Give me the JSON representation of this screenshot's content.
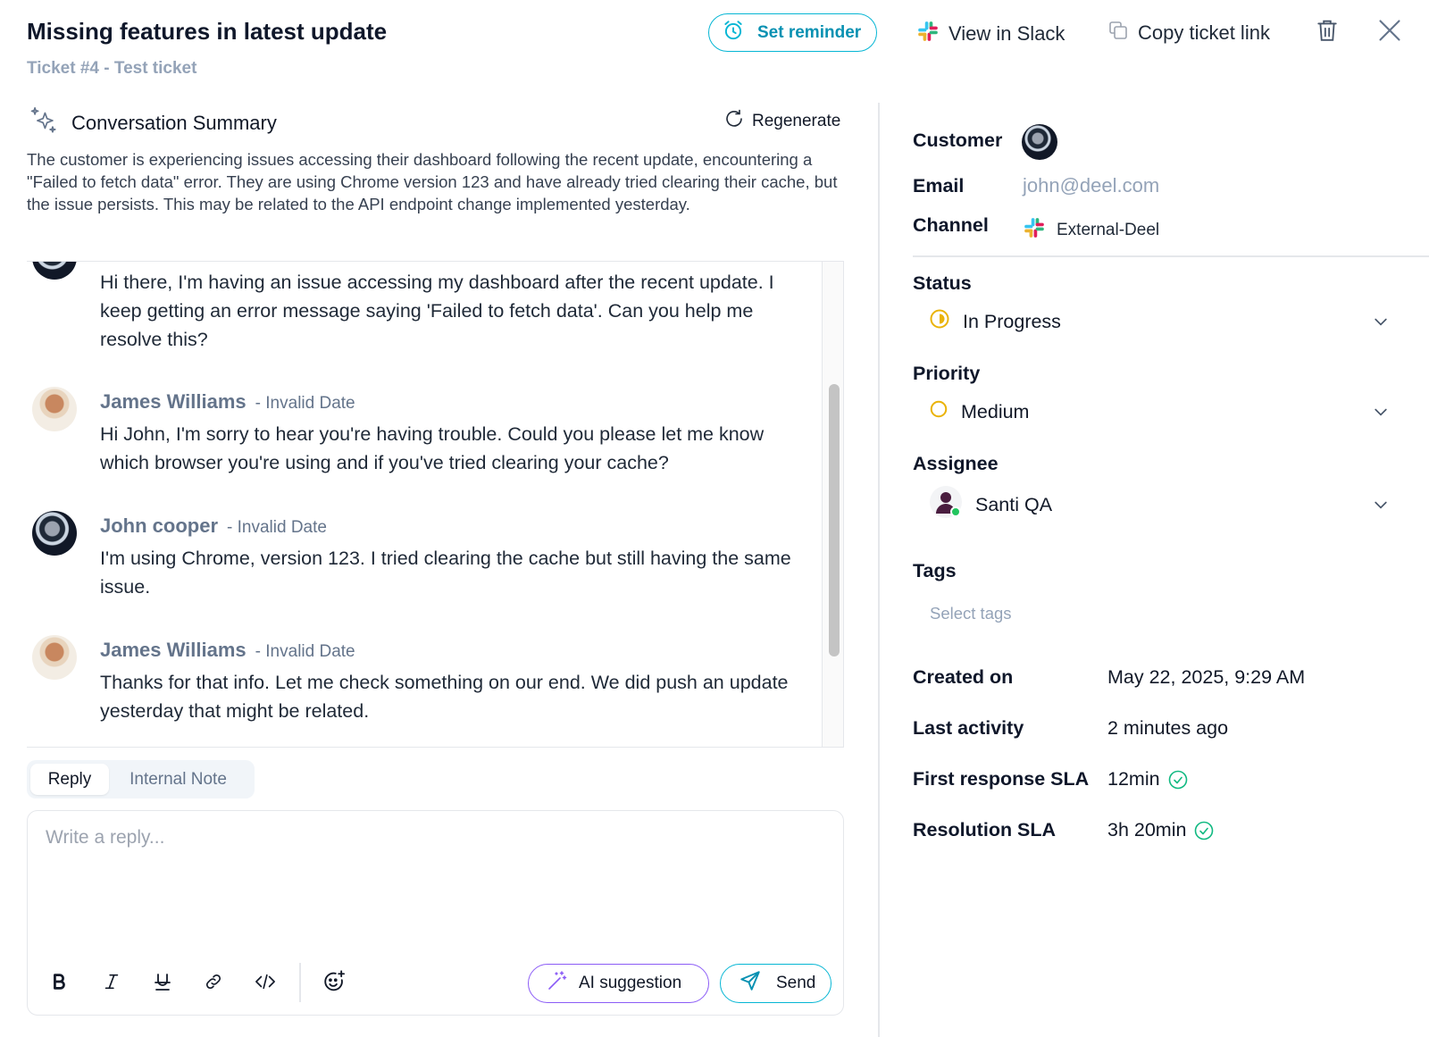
{
  "header": {
    "title": "Missing features in latest update",
    "subtitle": "Ticket #4 - Test ticket",
    "set_reminder_label": "Set reminder",
    "view_slack_label": "View in Slack",
    "copy_link_label": "Copy ticket link"
  },
  "summary": {
    "title": "Conversation Summary",
    "regenerate_label": "Regenerate",
    "text": "The customer is experiencing issues accessing their dashboard following the recent update, encountering a \"Failed to fetch data\" error. They are using Chrome version 123 and have already tried clearing their cache, but the issue persists. This may be related to the API endpoint change implemented yesterday."
  },
  "messages": [
    {
      "text": "Hi there, I'm having an issue accessing my dashboard after the recent update. I keep getting an error message saying 'Failed to fetch data'. Can you help me resolve this?"
    },
    {
      "name": "James Williams",
      "date": "- Invalid Date",
      "text": "Hi John, I'm sorry to hear you're having trouble. Could you please let me know which browser you're using and if you've tried clearing your cache?"
    },
    {
      "name": "John cooper",
      "date": "- Invalid Date",
      "text": "I'm using Chrome, version 123. I tried clearing the cache but still having the same issue."
    },
    {
      "name": "James Williams",
      "date": "- Invalid Date",
      "text": "Thanks for that info. Let me check something on our end. We did push an update yesterday that might be related."
    }
  ],
  "reply": {
    "tab_reply": "Reply",
    "tab_internal": "Internal Note",
    "placeholder": "Write a reply...",
    "ai_label": "AI suggestion",
    "send_label": "Send"
  },
  "details": {
    "customer_label": "Customer",
    "email_label": "Email",
    "email_value": "john@deel.com",
    "channel_label": "Channel",
    "channel_value": "External-Deel",
    "status_label": "Status",
    "status_value": "In Progress",
    "priority_label": "Priority",
    "priority_value": "Medium",
    "assignee_label": "Assignee",
    "assignee_value": "Santi QA",
    "tags_label": "Tags",
    "tags_placeholder": "Select tags",
    "created_label": "Created on",
    "created_value": "May 22, 2025, 9:29 AM",
    "activity_label": "Last activity",
    "activity_value": "2 minutes ago",
    "frsla_label": "First response SLA",
    "frsla_value": "12min",
    "ressla_label": "Resolution SLA",
    "ressla_value": "3h 20min"
  },
  "colors": {
    "accent_cyan": "#06b6d4",
    "ai_purple": "#8b5cf6",
    "status_yellow": "#eab308",
    "success_green": "#10b981"
  },
  "icons": [
    "alarm-clock-icon",
    "slack-icon",
    "copy-icon",
    "trash-icon",
    "close-icon",
    "sparkles-icon",
    "refresh-icon",
    "bold-icon",
    "italic-icon",
    "strikethrough-icon",
    "link-icon",
    "code-icon",
    "emoji-icon",
    "magic-wand-icon",
    "send-icon",
    "chevron-down-icon",
    "check-circle-icon"
  ]
}
